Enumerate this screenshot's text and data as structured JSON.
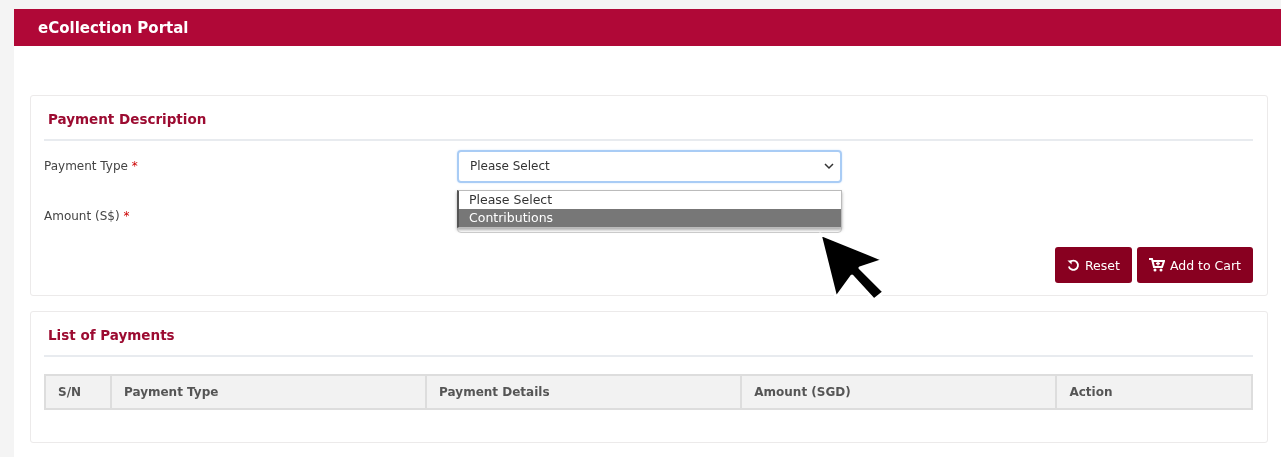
{
  "header": {
    "title": "eCollection Portal"
  },
  "payment_description": {
    "title": "Payment Description",
    "fields": [
      {
        "label": "Payment Type",
        "required_mark": "*",
        "kind": "select",
        "value": "Please Select",
        "expanded": true,
        "options": [
          {
            "label": "Please Select",
            "highlighted": false
          },
          {
            "label": "Contributions",
            "highlighted": true
          }
        ]
      },
      {
        "label": "Amount (S$)",
        "required_mark": "*",
        "kind": "input"
      }
    ],
    "buttons": [
      {
        "label": "Reset",
        "kind": "reset"
      },
      {
        "label": "Add to Cart",
        "kind": "cart"
      }
    ]
  },
  "list_of_payments": {
    "title": "List of Payments",
    "table": {
      "columns": [
        "S/N",
        "Payment Type",
        "Payment Details",
        "Amount (SGD)",
        "Action"
      ]
    }
  }
}
